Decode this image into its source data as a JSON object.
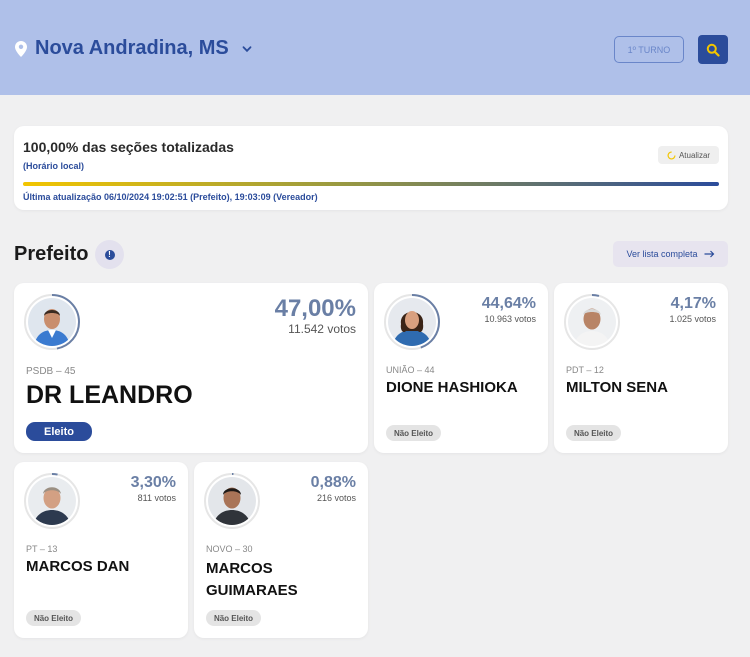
{
  "header": {
    "city": "Nova Andradina, MS",
    "round_button": "1º TURNO",
    "bg_color": "#afc0e9",
    "accent_color": "#2b4c9b"
  },
  "status": {
    "title": "100,00% das seções totalizadas",
    "local_time_note": "(Horário local)",
    "refresh_label": "Atualizar",
    "progress_percent": 100,
    "last_update": "Última atualização 06/10/2024 19:02:51 (Prefeito), 19:03:09 (Vereador)"
  },
  "section": {
    "title": "Prefeito",
    "info_icon_label": "!",
    "full_list_label": "Ver lista completa"
  },
  "candidates": [
    {
      "party": "PSDB – 45",
      "name": "DR LEANDRO",
      "percent": "47,00%",
      "votes": "11.542 votos",
      "status": "Eleito",
      "share": 0.47
    },
    {
      "party": "UNIÃO – 44",
      "name": "DIONE HASHIOKA",
      "percent": "44,64%",
      "votes": "10.963 votos",
      "status": "Não Eleito",
      "share": 0.4464
    },
    {
      "party": "PDT – 12",
      "name": "MILTON SENA",
      "percent": "4,17%",
      "votes": "1.025 votos",
      "status": "Não Eleito",
      "share": 0.0417
    },
    {
      "party": "PT – 13",
      "name": "MARCOS DAN",
      "percent": "3,30%",
      "votes": "811 votos",
      "status": "Não Eleito",
      "share": 0.033
    },
    {
      "party": "NOVO – 30",
      "name": "MARCOS GUIMARAES",
      "percent": "0,88%",
      "votes": "216 votos",
      "status": "Não Eleito",
      "share": 0.0088
    }
  ]
}
